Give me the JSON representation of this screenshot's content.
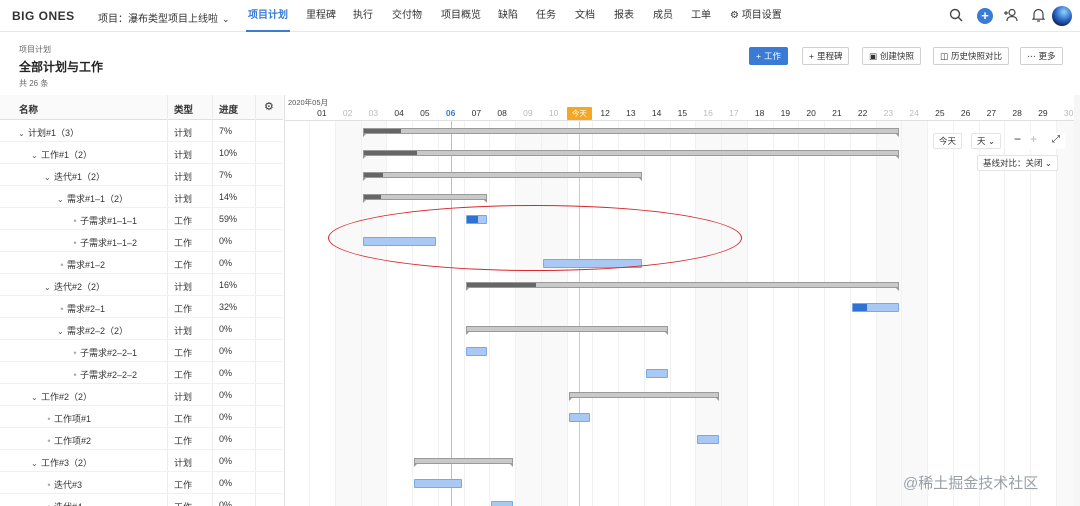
{
  "brand": "BIG ONES",
  "project_selector": {
    "label": "项目：瀑布类型项目上线啦"
  },
  "nav_tabs": [
    {
      "label": "项目计划",
      "active": true
    },
    {
      "label": "里程碑"
    },
    {
      "label": "执行"
    },
    {
      "label": "交付物"
    },
    {
      "label": "项目概览"
    },
    {
      "label": "缺陷"
    },
    {
      "label": "任务"
    },
    {
      "label": "文档"
    },
    {
      "label": "报表"
    },
    {
      "label": "成员"
    },
    {
      "label": "工单"
    },
    {
      "label": "项目设置"
    }
  ],
  "header": {
    "breadcrumb": "项目计划",
    "title": "全部计划与工作",
    "count": "共 26 条"
  },
  "toolbar": {
    "work": "工作",
    "milestone": "里程碑",
    "snapshot": "创建快照",
    "compare": "历史快照对比",
    "more": "更多"
  },
  "table": {
    "headers": {
      "name": "名称",
      "type": "类型",
      "progress": "进度"
    },
    "rows": [
      {
        "name": "计划#1（3）",
        "type": "计划",
        "progress": "7%",
        "indent": 0,
        "kind": "caret"
      },
      {
        "name": "工作#1（2）",
        "type": "计划",
        "progress": "10%",
        "indent": 1,
        "kind": "caret"
      },
      {
        "name": "迭代#1（2）",
        "type": "计划",
        "progress": "7%",
        "indent": 2,
        "kind": "caret"
      },
      {
        "name": "需求#1–1（2）",
        "type": "计划",
        "progress": "14%",
        "indent": 3,
        "kind": "caret"
      },
      {
        "name": "子需求#1–1–1",
        "type": "工作",
        "progress": "59%",
        "indent": 4,
        "kind": "dot"
      },
      {
        "name": "子需求#1–1–2",
        "type": "工作",
        "progress": "0%",
        "indent": 4,
        "kind": "dot"
      },
      {
        "name": "需求#1–2",
        "type": "工作",
        "progress": "0%",
        "indent": 3,
        "kind": "dot"
      },
      {
        "name": "迭代#2（2）",
        "type": "计划",
        "progress": "16%",
        "indent": 2,
        "kind": "caret"
      },
      {
        "name": "需求#2–1",
        "type": "工作",
        "progress": "32%",
        "indent": 3,
        "kind": "dot"
      },
      {
        "name": "需求#2–2（2）",
        "type": "计划",
        "progress": "0%",
        "indent": 3,
        "kind": "caret"
      },
      {
        "name": "子需求#2–2–1",
        "type": "工作",
        "progress": "0%",
        "indent": 4,
        "kind": "dot"
      },
      {
        "name": "子需求#2–2–2",
        "type": "工作",
        "progress": "0%",
        "indent": 4,
        "kind": "dot"
      },
      {
        "name": "工作#2（2）",
        "type": "计划",
        "progress": "0%",
        "indent": 1,
        "kind": "caret"
      },
      {
        "name": "工作项#1",
        "type": "工作",
        "progress": "0%",
        "indent": 2,
        "kind": "dot"
      },
      {
        "name": "工作项#2",
        "type": "工作",
        "progress": "0%",
        "indent": 2,
        "kind": "dot"
      },
      {
        "name": "工作#3（2）",
        "type": "计划",
        "progress": "0%",
        "indent": 1,
        "kind": "caret"
      },
      {
        "name": "迭代#3",
        "type": "工作",
        "progress": "0%",
        "indent": 2,
        "kind": "dot"
      },
      {
        "name": "迭代#4",
        "type": "工作",
        "progress": "0%",
        "indent": 2,
        "kind": "dot"
      }
    ]
  },
  "gantt": {
    "month_label": "2020年05月",
    "today_label": "今天",
    "days": [
      "01",
      "02",
      "03",
      "04",
      "05",
      "06",
      "07",
      "08",
      "09",
      "10",
      "11",
      "12",
      "13",
      "14",
      "15",
      "16",
      "17",
      "18",
      "19",
      "20",
      "21",
      "22",
      "23",
      "24",
      "25",
      "26",
      "27",
      "28",
      "29",
      "30"
    ],
    "weekend_days": [
      2,
      3,
      9,
      10,
      16,
      17,
      23,
      24,
      30
    ],
    "selected_day": 6,
    "today_day": 11,
    "bars": [
      {
        "row": 0,
        "kind": "summary",
        "start": 3,
        "end": 23,
        "progress": 0.07
      },
      {
        "row": 1,
        "kind": "summary",
        "start": 3,
        "end": 23,
        "progress": 0.1
      },
      {
        "row": 2,
        "kind": "summary",
        "start": 3,
        "end": 13,
        "progress": 0.07
      },
      {
        "row": 3,
        "kind": "summary",
        "start": 3,
        "end": 7,
        "progress": 0.14
      },
      {
        "row": 4,
        "kind": "task",
        "start": 7,
        "end": 7,
        "progress": 0.59
      },
      {
        "row": 5,
        "kind": "task",
        "start": 3,
        "end": 5,
        "progress": 0
      },
      {
        "row": 6,
        "kind": "task",
        "start": 10,
        "end": 13,
        "progress": 0
      },
      {
        "row": 7,
        "kind": "summary",
        "start": 7,
        "end": 23,
        "progress": 0.16
      },
      {
        "row": 8,
        "kind": "task",
        "start": 22,
        "end": 23,
        "progress": 0.32
      },
      {
        "row": 9,
        "kind": "summary",
        "start": 7,
        "end": 14,
        "progress": 0
      },
      {
        "row": 10,
        "kind": "task",
        "start": 7,
        "end": 7,
        "progress": 0
      },
      {
        "row": 11,
        "kind": "task",
        "start": 14,
        "end": 14,
        "progress": 0
      },
      {
        "row": 12,
        "kind": "summary",
        "start": 11,
        "end": 16,
        "progress": 0
      },
      {
        "row": 13,
        "kind": "task",
        "start": 11,
        "end": 11,
        "progress": 0
      },
      {
        "row": 14,
        "kind": "task",
        "start": 16,
        "end": 16,
        "progress": 0
      },
      {
        "row": 15,
        "kind": "summary",
        "start": 5,
        "end": 8,
        "progress": 0
      },
      {
        "row": 16,
        "kind": "task",
        "start": 5,
        "end": 6,
        "progress": 0
      },
      {
        "row": 17,
        "kind": "task",
        "start": 8,
        "end": 8,
        "progress": 0
      }
    ],
    "controls": {
      "today": "今天",
      "scale": "天",
      "baseline": "基线对比：关闭"
    }
  },
  "watermark": "@稀土掘金技术社区",
  "colors": {
    "accent": "#3a7bd5",
    "today": "#f5a623",
    "annotation": "#d9262b"
  }
}
